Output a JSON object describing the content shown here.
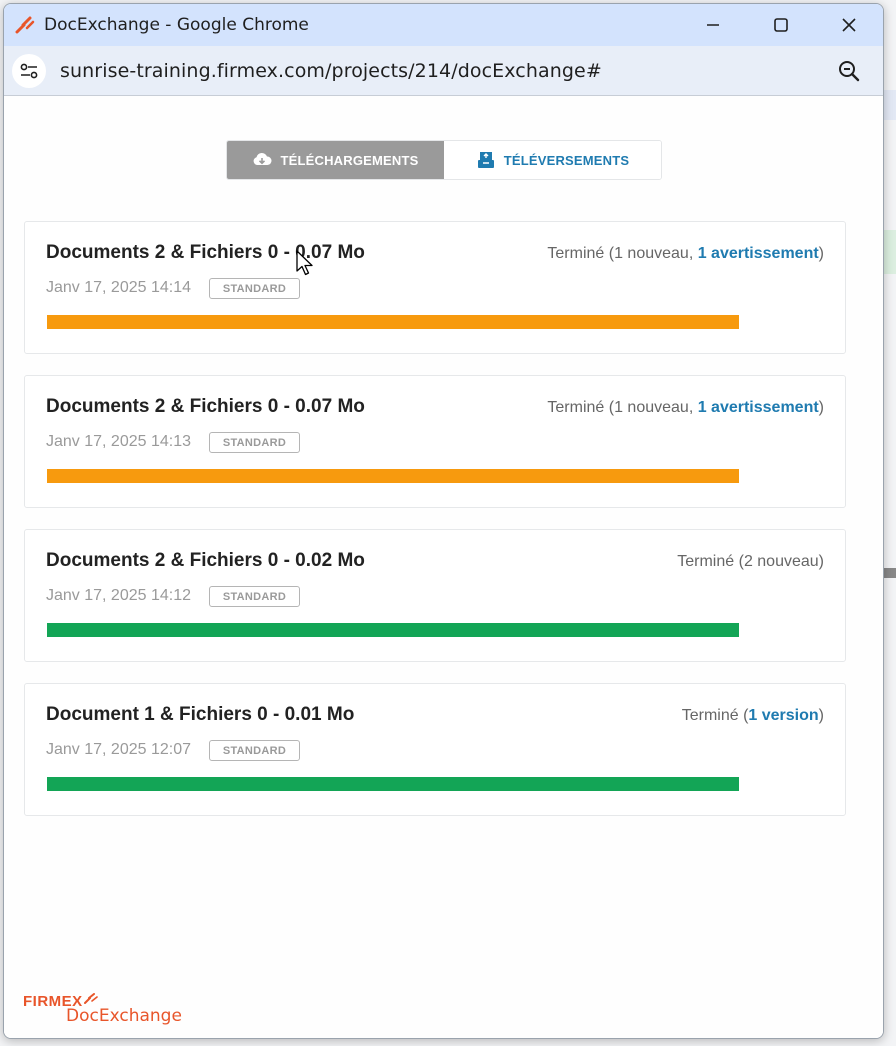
{
  "window": {
    "title": "DocExchange - Google Chrome",
    "url": "sunrise-training.firmex.com/projects/214/docExchange#"
  },
  "tabs": [
    {
      "label": "TÉLÉCHARGEMENTS",
      "icon": "cloud-download-icon",
      "active": true
    },
    {
      "label": "TÉLÉVERSEMENTS",
      "icon": "upload-tray-icon",
      "active": false
    }
  ],
  "cards": [
    {
      "title": "Documents 2 & Fichiers 0 - 0.07 Mo",
      "date": "Janv 17, 2025 14:14",
      "badge": "STANDARD",
      "status_prefix": "Terminé",
      "status_open": "(1 nouveau, ",
      "status_link": "1 avertissement",
      "status_close": ")",
      "progress": 1.0,
      "color": "#f79a0e"
    },
    {
      "title": "Documents 2 & Fichiers 0 - 0.07 Mo",
      "date": "Janv 17, 2025 14:13",
      "badge": "STANDARD",
      "status_prefix": "Terminé",
      "status_open": "(1 nouveau, ",
      "status_link": "1 avertissement",
      "status_close": ")",
      "progress": 1.0,
      "color": "#f79a0e"
    },
    {
      "title": "Documents 2 & Fichiers 0 - 0.02 Mo",
      "date": "Janv 17, 2025 14:12",
      "badge": "STANDARD",
      "status_prefix": "Terminé",
      "status_open": "(2 nouveau)",
      "status_link": "",
      "status_close": "",
      "progress": 1.0,
      "color": "#13a556"
    },
    {
      "title": "Document 1 & Fichiers 0 - 0.01 Mo",
      "date": "Janv 17, 2025 12:07",
      "badge": "STANDARD",
      "status_prefix": "Terminé",
      "status_open": "(",
      "status_link": "1 version",
      "status_close": ")",
      "progress": 1.0,
      "color": "#13a556"
    }
  ],
  "footer": {
    "brand": "FIRMEX",
    "product": "DocExchange"
  },
  "colors": {
    "accent": "#1f7bb0",
    "warning": "#f79a0e",
    "success": "#13a556",
    "brand": "#e8552a"
  }
}
